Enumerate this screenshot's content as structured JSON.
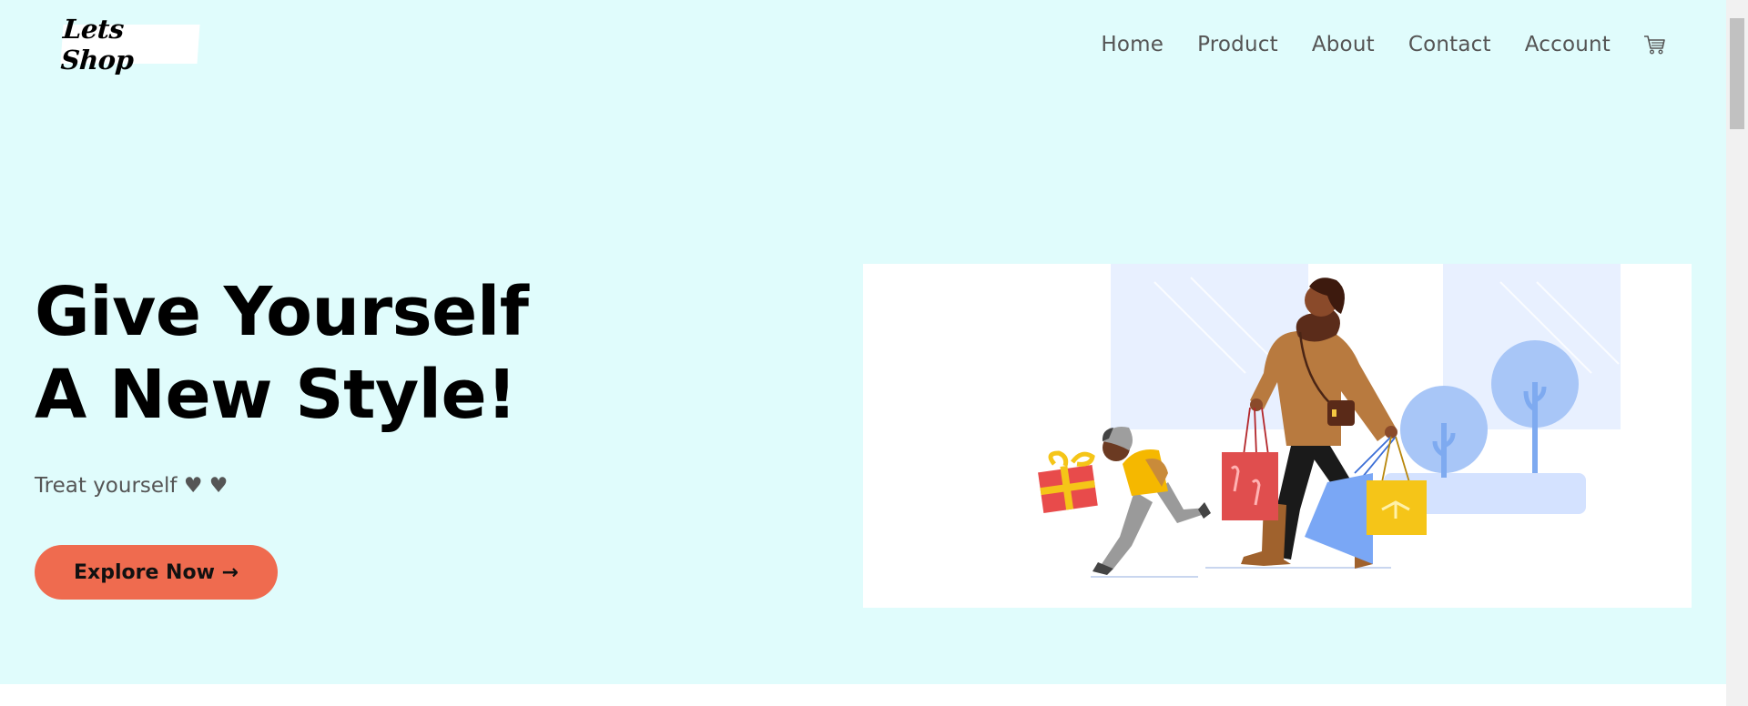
{
  "brand": {
    "logo_text": "Lets Shop"
  },
  "nav": {
    "items": [
      "Home",
      "Product",
      "About",
      "Contact",
      "Account"
    ],
    "cart_icon": "cart-icon"
  },
  "hero": {
    "headline_line1": "Give Yourself",
    "headline_line2": "A New Style!",
    "tagline": "Treat yourself ♥ ♥",
    "cta_label": "Explore Now →"
  },
  "colors": {
    "hero_bg": "#e0fcfc",
    "cta_bg": "#ef6b4f",
    "nav_text": "#555555"
  }
}
